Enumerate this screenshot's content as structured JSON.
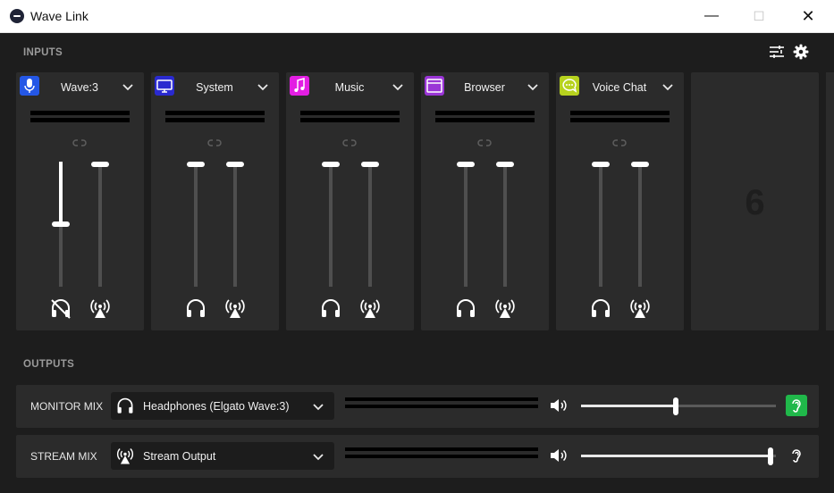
{
  "window": {
    "title": "Wave Link"
  },
  "inputs": {
    "section_label": "INPUTS",
    "channels": [
      {
        "name": "Wave:3",
        "icon": "microphone-icon",
        "color": "#2457e6",
        "monitor_level": 0.5,
        "stream_level": 1.0,
        "monitor_muted": true
      },
      {
        "name": "System",
        "icon": "monitor-icon",
        "color": "#2a2ad0",
        "monitor_level": 1.0,
        "stream_level": 1.0,
        "monitor_muted": false
      },
      {
        "name": "Music",
        "icon": "music-note-icon",
        "color": "#e31ee3",
        "monitor_level": 1.0,
        "stream_level": 1.0,
        "monitor_muted": false
      },
      {
        "name": "Browser",
        "icon": "browser-window-icon",
        "color": "#9a35d6",
        "monitor_level": 1.0,
        "stream_level": 1.0,
        "monitor_muted": false
      },
      {
        "name": "Voice Chat",
        "icon": "chat-bubble-icon",
        "color": "#b7d21e",
        "monitor_level": 1.0,
        "stream_level": 1.0,
        "monitor_muted": false
      }
    ],
    "empty_slot_number": "6"
  },
  "outputs": {
    "section_label": "OUTPUTS",
    "rows": [
      {
        "label": "MONITOR MIX",
        "device": "Headphones (Elgato Wave:3)",
        "device_icon": "headphones-icon",
        "volume": 0.5,
        "listen_active": true
      },
      {
        "label": "STREAM MIX",
        "device": "Stream Output",
        "device_icon": "broadcast-icon",
        "volume": 1.0,
        "listen_active": false
      }
    ]
  },
  "colors": {
    "background": "#1d1d1d",
    "panel": "#2b2b2b",
    "listen_green": "#20b84a"
  }
}
